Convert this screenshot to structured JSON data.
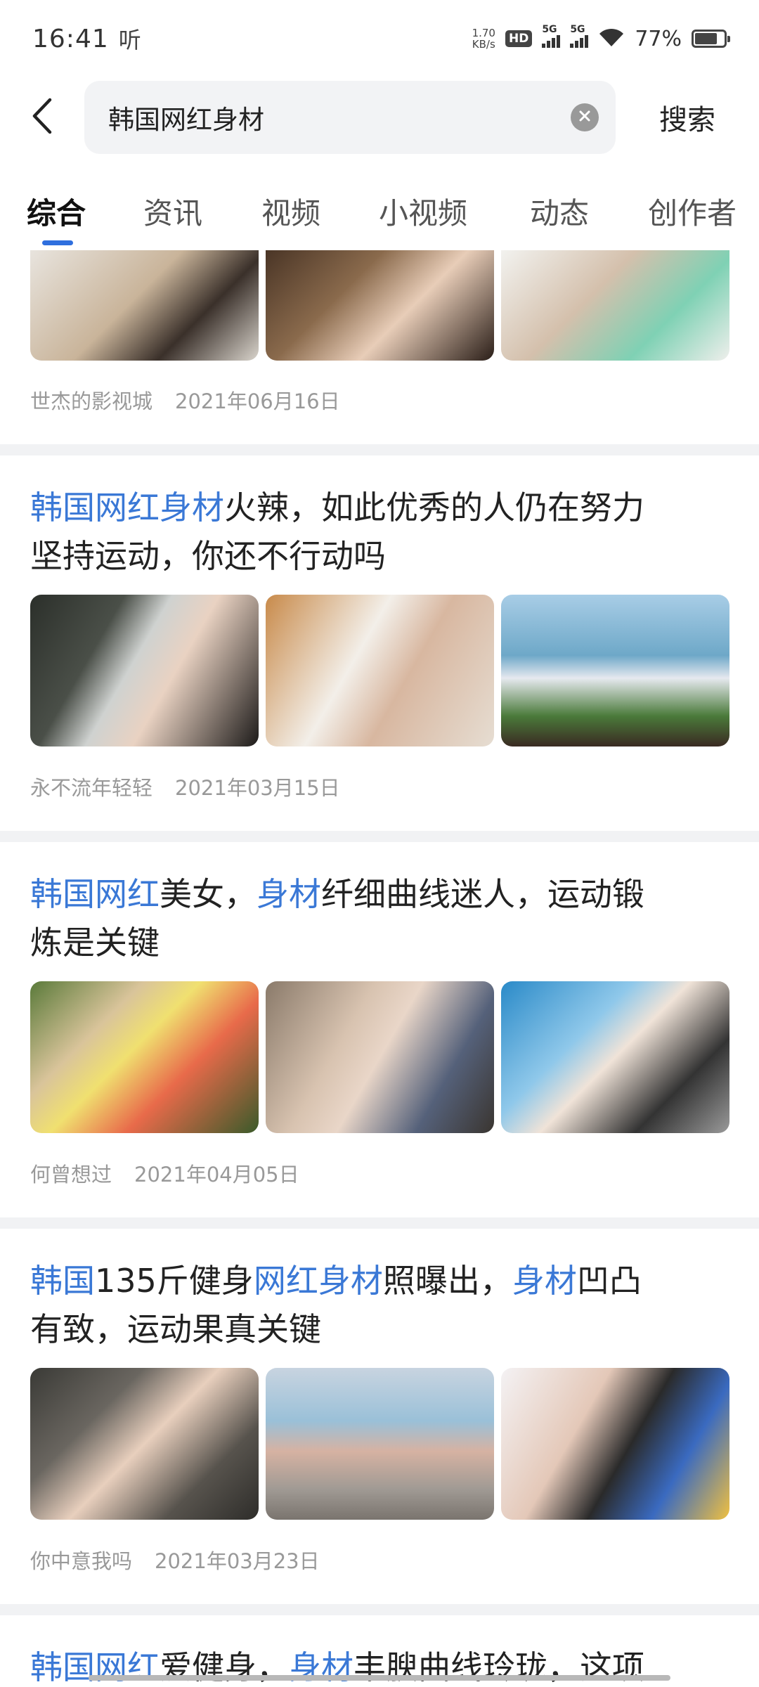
{
  "status_bar": {
    "time": "16:41",
    "hd_text": "听",
    "net_speed_value": "1.70",
    "net_speed_unit": "KB/s",
    "hd_badge": "HD",
    "signal1_label": "5G",
    "signal2_label": "5G",
    "battery_percent": "77%",
    "battery_level": 0.77
  },
  "search": {
    "query": "韩国网红身材",
    "search_button": "搜索"
  },
  "tabs": [
    {
      "label": "综合",
      "active": true
    },
    {
      "label": "资讯"
    },
    {
      "label": "视频"
    },
    {
      "label": "小视频"
    },
    {
      "label": "动态"
    },
    {
      "label": "创作者"
    }
  ],
  "accent_color": "#2f6fde",
  "highlight_color": "#3a78d6",
  "results": [
    {
      "author": "世杰的影视城",
      "date": "2021年06月16日"
    },
    {
      "title_line1": [
        "韩国网红身材",
        "火辣，如此优秀的人仍在努力"
      ],
      "title_line2": "坚持运动，你还不行动吗",
      "author": "永不流年轻轻",
      "date": "2021年03月15日"
    },
    {
      "title_line1": [
        "韩国网红",
        "美女，",
        "身材",
        "纤细曲线迷人，运动锻"
      ],
      "title_line2": "炼是关键",
      "author": "何曾想过",
      "date": "2021年04月05日"
    },
    {
      "title_line1": [
        "韩国",
        "135斤健身",
        "网红身材",
        "照曝出，",
        "身材",
        "凹凸"
      ],
      "title_line2": "有致，运动果真关键",
      "author": "你中意我吗",
      "date": "2021年03月23日"
    },
    {
      "title_line1": [
        "韩国网红",
        "爱健身，",
        "身材",
        "丰腴曲线玲珑，这项"
      ]
    }
  ]
}
